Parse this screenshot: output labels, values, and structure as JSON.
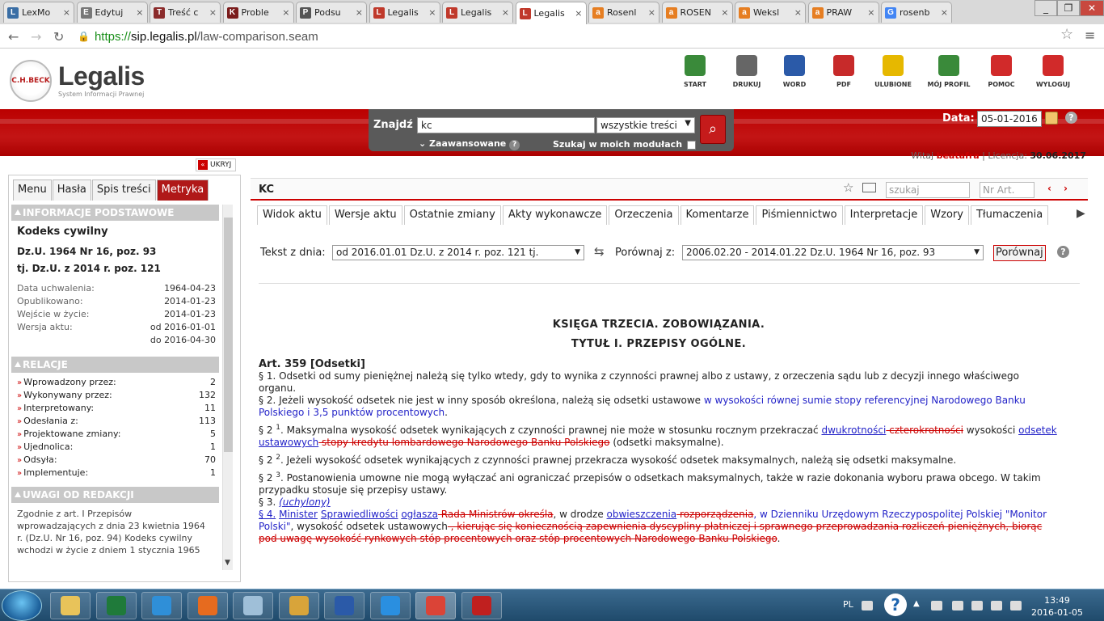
{
  "browser": {
    "tabs": [
      {
        "label": "LexMo",
        "icon_color": "#3a6ea5",
        "glyph": "L"
      },
      {
        "label": "Edytuj",
        "icon_color": "#777777",
        "glyph": "E"
      },
      {
        "label": "Treść c",
        "icon_color": "#8b2b2b",
        "glyph": "T"
      },
      {
        "label": "Proble",
        "icon_color": "#7a1c1c",
        "glyph": "K"
      },
      {
        "label": "Podsu",
        "icon_color": "#555555",
        "glyph": "P"
      },
      {
        "label": "Legalis",
        "icon_color": "#c0392b",
        "glyph": "L"
      },
      {
        "label": "Legalis",
        "icon_color": "#c0392b",
        "glyph": "L"
      },
      {
        "label": "Legalis",
        "icon_color": "#c0392b",
        "glyph": "L"
      },
      {
        "label": "Rosenl",
        "icon_color": "#e67e22",
        "glyph": "a"
      },
      {
        "label": "ROSEN",
        "icon_color": "#e67e22",
        "glyph": "a"
      },
      {
        "label": "Weksl",
        "icon_color": "#e67e22",
        "glyph": "a"
      },
      {
        "label": "PRAW",
        "icon_color": "#e67e22",
        "glyph": "a"
      },
      {
        "label": "rosenb",
        "icon_color": "#4285f4",
        "glyph": "G"
      }
    ],
    "active_tab_index": 7,
    "url_scheme": "https://",
    "url_host": "sip.legalis.pl",
    "url_path": "/law-comparison.seam"
  },
  "header": {
    "logo_name": "Legalis",
    "logo_sub": "System Informacji Prawnej",
    "logo_badge": "C.H.BECK",
    "tools": [
      {
        "label": "START",
        "icon": "home-icon",
        "color": "#3a8a3a"
      },
      {
        "label": "DRUKUJ",
        "icon": "printer-icon",
        "color": "#666666"
      },
      {
        "label": "WORD",
        "icon": "word-icon",
        "color": "#2b5aa8"
      },
      {
        "label": "PDF",
        "icon": "pdf-icon",
        "color": "#c72a2a"
      },
      {
        "label": "ULUBIONE",
        "icon": "star-icon",
        "color": "#e6b800"
      },
      {
        "label": "MÓJ PROFIL",
        "icon": "profile-icon",
        "color": "#3a8a3a"
      },
      {
        "label": "POMOC",
        "icon": "lifebuoy-icon",
        "color": "#d12a2a"
      },
      {
        "label": "WYLOGUJ",
        "icon": "power-icon",
        "color": "#d12a2a"
      }
    ],
    "search": {
      "label": "Znajdź",
      "value": "kc",
      "scope": "wszystkie treści",
      "advanced": "Zaawansowane",
      "in_modules": "Szukaj w moich modułach"
    },
    "date_label": "Data:",
    "date_value": "05-01-2016",
    "welcome_prefix": "Witaj",
    "user": "beatafra",
    "license_label": "Licencja:",
    "license_date": "30.06.2017"
  },
  "sidebar": {
    "hide_label": "UKRYJ",
    "tabs": [
      "Menu",
      "Hasła",
      "Spis treści",
      "Metryka"
    ],
    "active_tab": 3,
    "info_header": "INFORMACJE PODSTAWOWE",
    "act_name": "Kodeks cywilny",
    "act_ref1": "Dz.U. 1964 Nr 16, poz. 93",
    "act_ref2": "tj. Dz.U. z 2014 r. poz. 121",
    "meta": [
      {
        "k": "Data uchwalenia:",
        "v": "1964-04-23"
      },
      {
        "k": "Opublikowano:",
        "v": "2014-01-23"
      },
      {
        "k": "Wejście w życie:",
        "v": "2014-01-23"
      },
      {
        "k": "Wersja aktu:",
        "v": "od 2016-01-01"
      },
      {
        "k": "",
        "v": "do 2016-04-30"
      }
    ],
    "rel_header": "RELACJE",
    "relations": [
      {
        "k": "Wprowadzony przez:",
        "v": "2"
      },
      {
        "k": "Wykonywany przez:",
        "v": "132"
      },
      {
        "k": "Interpretowany:",
        "v": "11"
      },
      {
        "k": "Odesłania z:",
        "v": "113"
      },
      {
        "k": "Projektowane zmiany:",
        "v": "5"
      },
      {
        "k": "Ujednolica:",
        "v": "1"
      },
      {
        "k": "Odsyła:",
        "v": "70"
      },
      {
        "k": "Implementuje:",
        "v": "1"
      }
    ],
    "notes_header": "UWAGI OD REDAKCJI",
    "notes_text": "Zgodnie z art. I Przepisów wprowadzających z dnia 23 kwietnia 1964 r. (Dz.U. Nr 16, poz. 94) Kodeks cywilny wchodzi w życie z dniem 1 stycznia 1965"
  },
  "main": {
    "title": "KC",
    "search_placeholder": "szukaj",
    "art_placeholder": "Nr Art.",
    "tabs": [
      "Widok aktu",
      "Wersje aktu",
      "Ostatnie zmiany",
      "Akty wykonawcze",
      "Orzeczenia",
      "Komentarze",
      "Piśmiennictwo",
      "Interpretacje",
      "Wzory",
      "Tłumaczenia"
    ],
    "text_from_label": "Tekst z dnia:",
    "text_from_value": "od 2016.01.01 Dz.U. z 2014 r. poz. 121 tj.",
    "compare_label": "Porównaj z:",
    "compare_value": "2006.02.20 - 2014.01.22 Dz.U. 1964 Nr 16, poz. 93",
    "compare_button": "Porównaj"
  },
  "document": {
    "book": "KSIĘGA TRZECIA. ZOBOWIĄZANIA.",
    "title": "TYTUŁ I. PRZEPISY OGÓLNE.",
    "article": "Art. 359 [Odsetki]",
    "p1": "§ 1. Odsetki od sumy pieniężnej należą się tylko wtedy, gdy to wynika z czynności prawnej albo z ustawy, z orzeczenia sądu lub z decyzji innego właściwego organu.",
    "p2a": "§ 2. Jeżeli wysokość odsetek nie jest w inny sposób określona, należą się odsetki ustawowe ",
    "p2b": "w wysokości równej sumie stopy referencyjnej Narodowego Banku Polskiego i 3,5 punktów procentowych",
    "p2c": ".",
    "p21_num": "§ 2",
    "p21_sup": "1",
    "p21a": ". Maksymalna wysokość odsetek wynikających z czynności prawnej nie może w stosunku rocznym przekraczać ",
    "p21b": "dwukrotności",
    "p21c": " czterokrotności",
    "p21d": " wysokości ",
    "p21e": "odsetek ustawowych",
    "p21f": " stopy kredytu lombardowego Narodowego Banku Polskiego",
    "p21g": " (odsetki maksymalne).",
    "p22_num": "§ 2",
    "p22_sup": "2",
    "p22a": ". Jeżeli wysokość odsetek wynikających z czynności prawnej przekracza wysokość odsetek maksymalnych, należą się odsetki maksymalne.",
    "p23_num": "§ 2",
    "p23_sup": "3",
    "p23a": ". Postanowienia umowne nie mogą wyłączać ani ograniczać przepisów o odsetkach maksymalnych, także w razie dokonania wyboru prawa obcego. W takim przypadku stosuje się przepisy ustawy.",
    "p3a": "§ 3. ",
    "p3b": "(uchylony)",
    "p4a": "§ 4.",
    "p4b": "Minister",
    "p4c": "Sprawiedliwości",
    "p4d": "ogłasza",
    "p4e": " Rada Ministrów określa",
    "p4f": ", w drodze ",
    "p4g": "obwieszczenia",
    "p4h": " rozporządzenia",
    "p4i": ", w Dzienniku Urzędowym Rzeczypospolitej Polskiej \"Monitor Polski\"",
    "p4j": ", wysokość odsetek ustawowych",
    "p4k": " , kierując się koniecznością zapewnienia dyscypliny płatniczej i sprawnego przeprowadzania rozliczeń pieniężnych, biorąc pod uwagę wysokość rynkowych stóp procentowych oraz stóp procentowych Narodowego Banku Polskiego",
    "p4l": "."
  },
  "taskbar": {
    "apps": [
      {
        "name": "explorer",
        "color": "#e8c35a"
      },
      {
        "name": "excel",
        "color": "#1f7a3a"
      },
      {
        "name": "network",
        "color": "#2f8fd8"
      },
      {
        "name": "firefox",
        "color": "#e66b1f"
      },
      {
        "name": "window",
        "color": "#9fbfd8"
      },
      {
        "name": "paint",
        "color": "#d8a43a"
      },
      {
        "name": "word-doc",
        "color": "#2b5aa8"
      },
      {
        "name": "ie",
        "color": "#2a8fe0"
      },
      {
        "name": "chrome",
        "color": "#db4437"
      },
      {
        "name": "acrobat",
        "color": "#c0201f"
      }
    ],
    "active_app": 8,
    "lang": "PL",
    "time": "13:49",
    "date": "2016-01-05"
  }
}
